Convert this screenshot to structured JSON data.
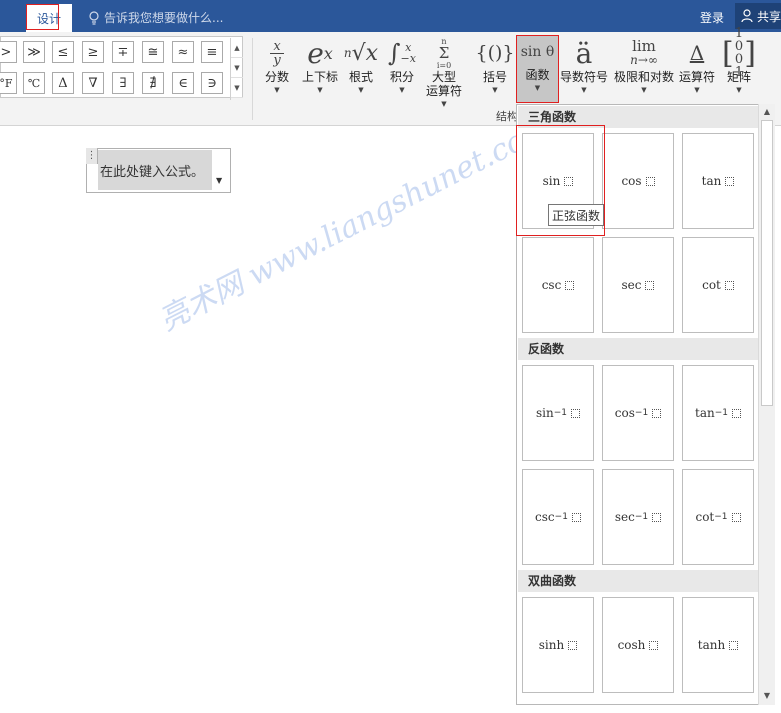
{
  "titlebar": {
    "tab_design": "设计",
    "tell_me": "告诉我您想要做什么...",
    "login": "登录",
    "share": "共享"
  },
  "symbols": {
    "row1": [
      ">",
      "≫",
      "≤",
      "≥",
      "∓",
      "≅",
      "≈",
      "≡"
    ],
    "row2": [
      "°F",
      "℃",
      "Δ",
      "∇",
      "∃",
      "∄",
      "∈",
      "∋"
    ]
  },
  "ribbon": {
    "fraction": "分数",
    "script": "上下标",
    "radical": "根式",
    "integral": "积分",
    "large_operator_1": "大型",
    "large_operator_2": "运算符",
    "bracket": "括号",
    "function": "函数",
    "accent": "导数符号",
    "limit_log": "极限和对数",
    "operator": "运算符",
    "matrix": "矩阵",
    "group_label": "结构"
  },
  "document": {
    "equation_placeholder": "在此处键入公式。"
  },
  "function_panel": {
    "sections": [
      {
        "title": "三角函数",
        "items": [
          "sin",
          "cos",
          "tan",
          "csc",
          "sec",
          "cot"
        ]
      },
      {
        "title": "反函数",
        "items": [
          "sin",
          "cos",
          "tan",
          "csc",
          "sec",
          "cot"
        ],
        "superscript": "−1"
      },
      {
        "title": "双曲函数",
        "items": [
          "sinh",
          "cosh",
          "tanh"
        ]
      }
    ],
    "tooltip": "正弦函数"
  },
  "watermark": "亮术网 www.liangshunet.com",
  "colors": {
    "titlebar": "#2b579a",
    "highlight": "#e02020"
  }
}
